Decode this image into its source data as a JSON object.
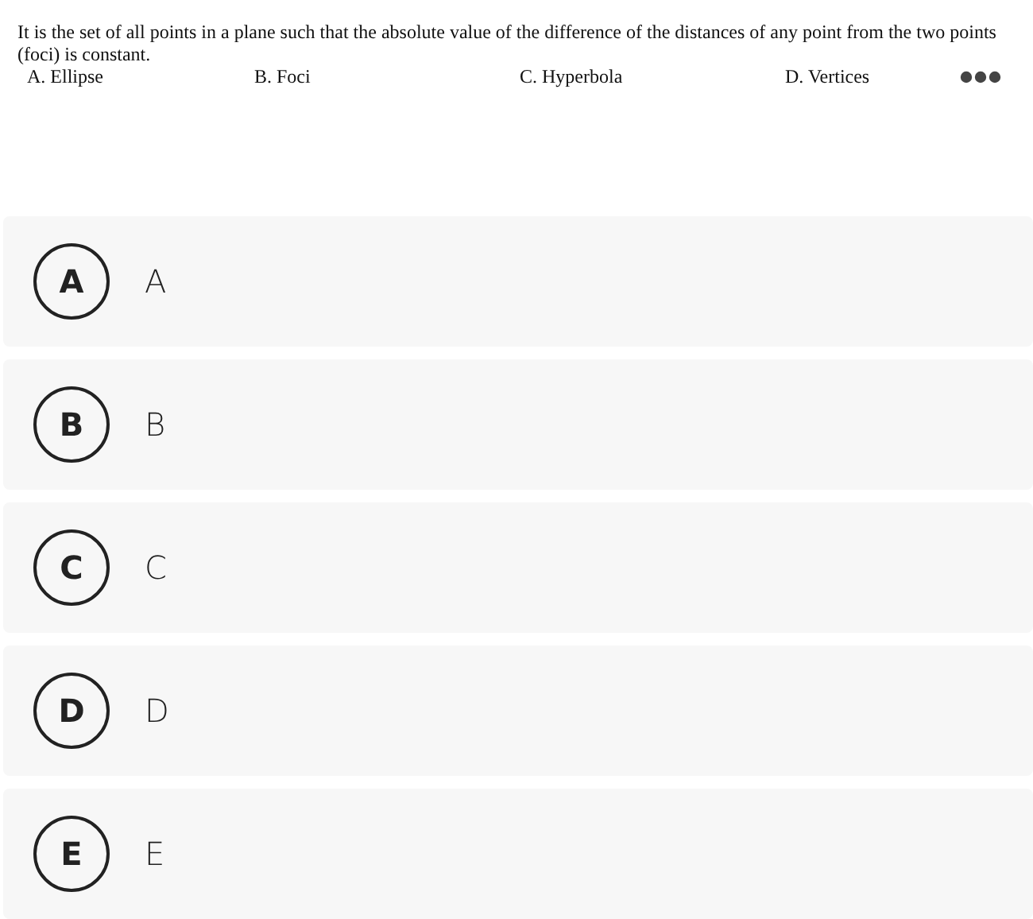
{
  "question": {
    "text": "It is the set of all points in a plane such that the absolute value of the difference of the distances of any point from the two points (foci) is constant.",
    "choices": [
      "A.  Ellipse",
      "B. Foci",
      "C. Hyperbola",
      "D. Vertices"
    ]
  },
  "options": [
    {
      "letter": "A",
      "label": "A",
      "selected": false
    },
    {
      "letter": "B",
      "label": "B",
      "selected": false
    },
    {
      "letter": "C",
      "label": "C",
      "selected": false
    },
    {
      "letter": "D",
      "label": "D",
      "selected": false
    },
    {
      "letter": "E",
      "label": "E",
      "selected": false
    }
  ]
}
